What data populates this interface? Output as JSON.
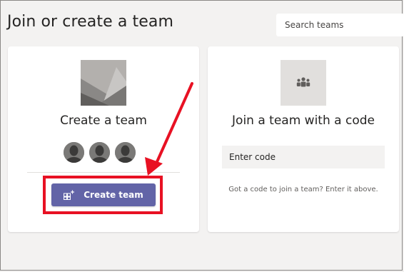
{
  "header": {
    "title": "Join or create a team",
    "search_placeholder": "Search teams"
  },
  "create_card": {
    "title": "Create a team",
    "button_label": "Create team",
    "avatars": [
      "person",
      "person",
      "person"
    ]
  },
  "join_card": {
    "title": "Join a team with a code",
    "code_placeholder": "Enter code",
    "hint": "Got a code to join a team? Enter it above."
  },
  "colors": {
    "accent": "#6264a7",
    "annotation": "#e81123",
    "background": "#f3f2f1"
  },
  "icons": {
    "team_thumbnail": "image-placeholder-icon",
    "join_team": "people-icon",
    "create_button": "add-team-icon"
  }
}
